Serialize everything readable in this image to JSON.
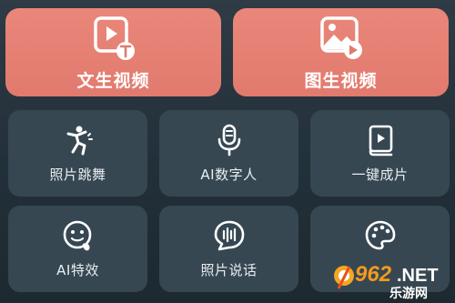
{
  "hero_cards": [
    {
      "label": "文生视频",
      "icon": "text-to-video-icon"
    },
    {
      "label": "图生视频",
      "icon": "image-to-video-icon"
    }
  ],
  "tools": [
    {
      "label": "照片跳舞",
      "icon": "dancer-icon"
    },
    {
      "label": "AI数字人",
      "icon": "microphone-icon"
    },
    {
      "label": "一键成片",
      "icon": "video-book-icon"
    },
    {
      "label": "AI特效",
      "icon": "face-effect-icon"
    },
    {
      "label": "照片说话",
      "icon": "speech-bubble-icon"
    },
    {
      "label": "",
      "icon": "palette-icon"
    }
  ],
  "watermark": {
    "text": "962.NET",
    "subtext": "乐游网"
  },
  "colors": {
    "hero": "#e27a6e",
    "tile": "#364752",
    "background": "#223039"
  }
}
